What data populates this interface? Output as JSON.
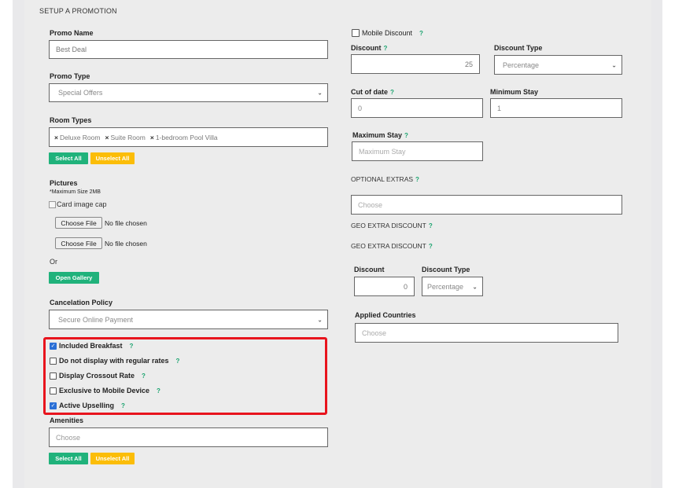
{
  "section_title": "SETUP A PROMOTION",
  "promo_name": {
    "label": "Promo Name",
    "value": "Best Deal"
  },
  "promo_type": {
    "label": "Promo Type",
    "value": "Special Offers"
  },
  "room_types": {
    "label": "Room Types",
    "tags": [
      "Deluxe Room",
      "Suite Room",
      "1-bedroom Pool Villa"
    ],
    "select_all": "Select All",
    "unselect_all": "Unselect All"
  },
  "pictures": {
    "label": "Pictures",
    "note": "*Maximum Size 2MB",
    "image_alt": "Card image cap",
    "choose_file": "Choose File",
    "no_file": "No file chosen",
    "or": "Or",
    "open_gallery": "Open Gallery"
  },
  "cancelation": {
    "label": "Cancelation Policy",
    "value": "Secure Online Payment"
  },
  "options": [
    {
      "label": "Included Breakfast",
      "checked": true
    },
    {
      "label": "Do not display with regular rates",
      "checked": false
    },
    {
      "label": "Display Crossout Rate",
      "checked": false
    },
    {
      "label": "Exclusive to Mobile Device",
      "checked": false
    },
    {
      "label": "Active Upselling",
      "checked": true
    }
  ],
  "amenities": {
    "label": "Amenities",
    "placeholder": "Choose",
    "select_all": "Select All",
    "unselect_all": "Unselect All"
  },
  "right": {
    "mobile_discount": "Mobile Discount",
    "discount_label": "Discount",
    "discount_value": "25",
    "discount_type_label": "Discount Type",
    "discount_type_value": "Percentage",
    "cutoff_label": "Cut of date",
    "cutoff_value": "0",
    "min_stay_label": "Minimum Stay",
    "min_stay_value": "1",
    "max_stay_label": "Maximum Stay",
    "max_stay_placeholder": "Maximum Stay",
    "optional_extras": "OPTIONAL EXTRAS",
    "optional_extras_placeholder": "Choose",
    "geo1": "GEO EXTRA DISCOUNT",
    "geo2": "GEO EXTRA DISCOUNT",
    "geo_discount_label": "Discount",
    "geo_discount_value": "0",
    "geo_type_label": "Discount Type",
    "geo_type_value": "Percentage",
    "applied_countries_label": "Applied Countries",
    "applied_countries_placeholder": "Choose"
  },
  "help_mark": "?",
  "colors": {
    "green": "#20b27b",
    "yellow": "#fbbd08",
    "highlight": "#e8141d",
    "check": "#2a6fd6"
  }
}
